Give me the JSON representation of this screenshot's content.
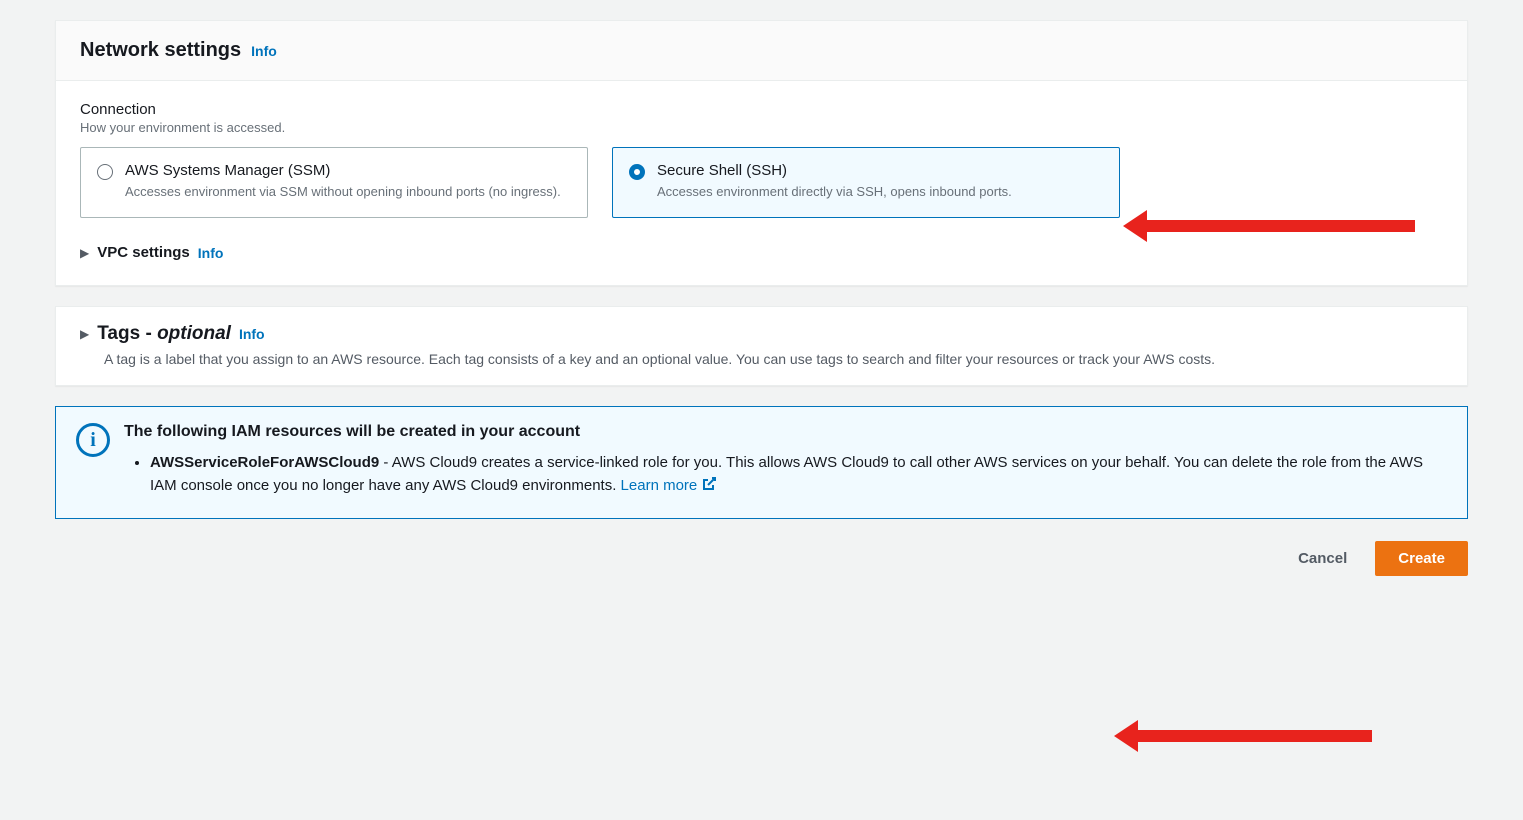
{
  "network": {
    "title": "Network settings",
    "info": "Info",
    "connection": {
      "label": "Connection",
      "desc": "How your environment is accessed.",
      "options": {
        "ssm": {
          "title": "AWS Systems Manager (SSM)",
          "desc": "Accesses environment via SSM without opening inbound ports (no ingress)."
        },
        "ssh": {
          "title": "Secure Shell (SSH)",
          "desc": "Accesses environment directly via SSH, opens inbound ports."
        }
      }
    },
    "vpc": {
      "label": "VPC settings",
      "info": "Info"
    }
  },
  "tags": {
    "title": "Tags - ",
    "optional": "optional",
    "info": "Info",
    "desc": "A tag is a label that you assign to an AWS resource. Each tag consists of a key and an optional value. You can use tags to search and filter your resources or track your AWS costs."
  },
  "iam": {
    "title": "The following IAM resources will be created in your account",
    "role_name": "AWSServiceRoleForAWSCloud9",
    "role_desc": " - AWS Cloud9 creates a service-linked role for you. This allows AWS Cloud9 to call other AWS services on your behalf. You can delete the role from the AWS IAM console once you no longer have any AWS Cloud9 environments. ",
    "learn_more": "Learn more"
  },
  "actions": {
    "cancel": "Cancel",
    "create": "Create"
  }
}
